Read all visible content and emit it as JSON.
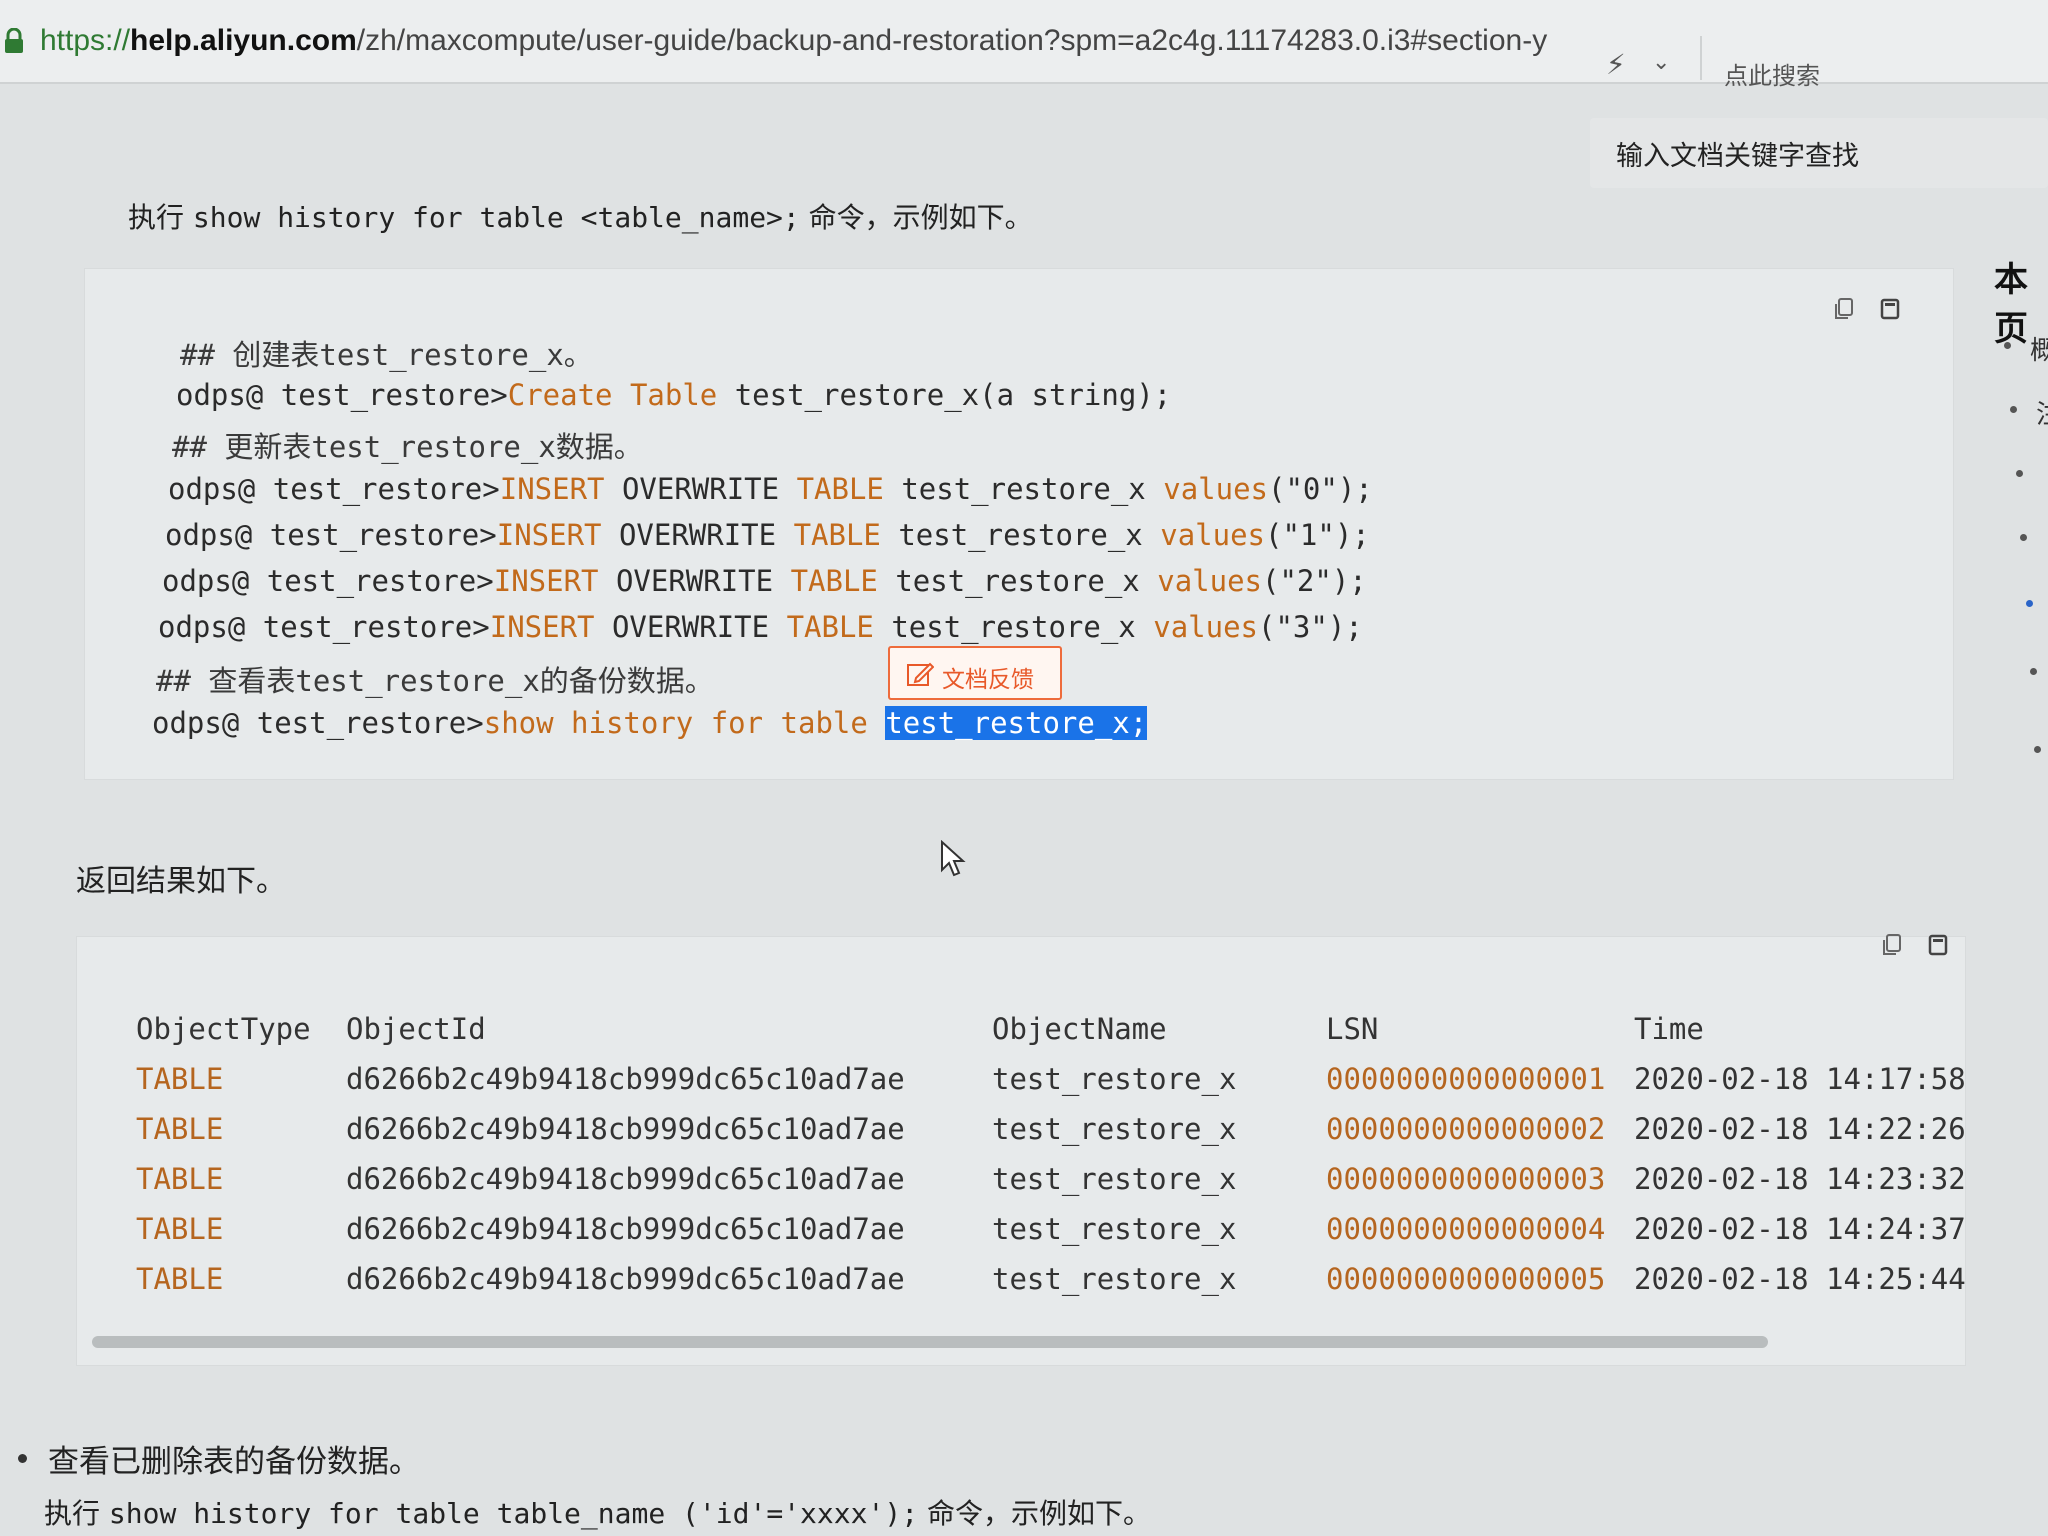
{
  "browser": {
    "url_proto": "https://",
    "url_host": "help.aliyun.com",
    "url_rest": "/zh/maxcompute/user-guide/backup-and-restoration?spm=a2c4g.11174283.0.i3#section-y",
    "search_hint": "点此搜索"
  },
  "doc_search": {
    "placeholder": "输入文档关键字查找"
  },
  "toc": {
    "title": "本页",
    "items": [
      "概",
      "注"
    ]
  },
  "intro_1": {
    "prefix": "执行 ",
    "command": "show history for table <table_name>;",
    "suffix": " 命令，示例如下。"
  },
  "code_block_1": {
    "lines": [
      {
        "parts": [
          {
            "t": "## 创建表test_restore_x。",
            "c": "cm"
          }
        ]
      },
      {
        "parts": [
          {
            "t": "odps@ test_restore>",
            "c": ""
          },
          {
            "t": "Create Table",
            "c": "kw"
          },
          {
            "t": " test_restore_x(a string);",
            "c": ""
          }
        ]
      },
      {
        "parts": [
          {
            "t": "## 更新表test_restore_x数据。",
            "c": "cm"
          }
        ]
      },
      {
        "parts": [
          {
            "t": "odps@ test_restore>",
            "c": ""
          },
          {
            "t": "INSERT",
            "c": "kw"
          },
          {
            "t": " OVERWRITE ",
            "c": ""
          },
          {
            "t": "TABLE",
            "c": "kw"
          },
          {
            "t": " test_restore_x ",
            "c": ""
          },
          {
            "t": "values",
            "c": "kw"
          },
          {
            "t": "(\"0\");",
            "c": ""
          }
        ]
      },
      {
        "parts": [
          {
            "t": "odps@ test_restore>",
            "c": ""
          },
          {
            "t": "INSERT",
            "c": "kw"
          },
          {
            "t": " OVERWRITE ",
            "c": ""
          },
          {
            "t": "TABLE",
            "c": "kw"
          },
          {
            "t": " test_restore_x ",
            "c": ""
          },
          {
            "t": "values",
            "c": "kw"
          },
          {
            "t": "(\"1\");",
            "c": ""
          }
        ]
      },
      {
        "parts": [
          {
            "t": "odps@ test_restore>",
            "c": ""
          },
          {
            "t": "INSERT",
            "c": "kw"
          },
          {
            "t": " OVERWRITE ",
            "c": ""
          },
          {
            "t": "TABLE",
            "c": "kw"
          },
          {
            "t": " test_restore_x ",
            "c": ""
          },
          {
            "t": "values",
            "c": "kw"
          },
          {
            "t": "(\"2\");",
            "c": ""
          }
        ]
      },
      {
        "parts": [
          {
            "t": "odps@ test_restore>",
            "c": ""
          },
          {
            "t": "INSERT",
            "c": "kw"
          },
          {
            "t": " OVERWRITE ",
            "c": ""
          },
          {
            "t": "TABLE",
            "c": "kw"
          },
          {
            "t": " test_restore_x ",
            "c": ""
          },
          {
            "t": "values",
            "c": "kw"
          },
          {
            "t": "(\"3\");",
            "c": ""
          }
        ]
      },
      {
        "parts": [
          {
            "t": "## 查看表test_restore_x的备份数据。",
            "c": "cm"
          }
        ]
      },
      {
        "parts": [
          {
            "t": "odps@ test_restore>",
            "c": ""
          },
          {
            "t": "show history for table",
            "c": "kw"
          },
          {
            "t": " ",
            "c": ""
          },
          {
            "t": "test_restore_x;",
            "c": "sel"
          }
        ]
      }
    ]
  },
  "feedback_label": "文档反馈",
  "result_intro": "返回结果如下。",
  "result_table": {
    "headers": [
      "ObjectType",
      "ObjectId",
      "ObjectName",
      "LSN",
      "Time"
    ],
    "rows": [
      [
        "TABLE",
        "d6266b2c49b9418cb999dc65c10ad7ae",
        "test_restore_x",
        "0000000000000001",
        "2020-02-18 14:17:58"
      ],
      [
        "TABLE",
        "d6266b2c49b9418cb999dc65c10ad7ae",
        "test_restore_x",
        "0000000000000002",
        "2020-02-18 14:22:26"
      ],
      [
        "TABLE",
        "d6266b2c49b9418cb999dc65c10ad7ae",
        "test_restore_x",
        "0000000000000003",
        "2020-02-18 14:23:32"
      ],
      [
        "TABLE",
        "d6266b2c49b9418cb999dc65c10ad7ae",
        "test_restore_x",
        "0000000000000004",
        "2020-02-18 14:24:37"
      ],
      [
        "TABLE",
        "d6266b2c49b9418cb999dc65c10ad7ae",
        "test_restore_x",
        "0000000000000005",
        "2020-02-18 14:25:44"
      ]
    ]
  },
  "bullet_heading": "查看已删除表的备份数据。",
  "intro_2": {
    "prefix": "执行 ",
    "command": "show history for table table_name ('id'='xxxx');",
    "suffix": " 命令，示例如下。"
  },
  "icons": {
    "copy": "copy-icon",
    "fullscreen": "fullscreen-icon",
    "lock": "lock-icon",
    "edit": "edit-icon",
    "cursor": "mouse-cursor-icon"
  },
  "colors": {
    "keyword": "#c26a1b",
    "selection": "#1a73e8",
    "feedback": "#e8592a"
  }
}
